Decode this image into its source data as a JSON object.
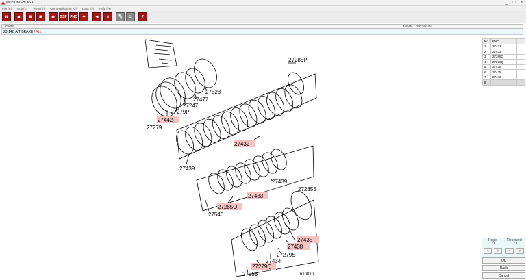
{
  "window": {
    "title": "MITSUBISHI ASA",
    "controls": [
      "_",
      "□",
      "×"
    ]
  },
  "menu": [
    "File (F)",
    "Edit (E)",
    "View (V)",
    "Communication (C)",
    "Data (D)",
    "Help (H)"
  ],
  "toolbar": {
    "buttons": [
      {
        "name": "exit",
        "glyph": "▮▮"
      },
      {
        "name": "tool-2",
        "glyph": "◼"
      },
      {
        "name": "print",
        "glyph": "▤"
      },
      {
        "name": "tool-4",
        "glyph": "▣"
      },
      {
        "name": "tool-5",
        "glyph": "◉"
      },
      {
        "name": "gsp",
        "glyph": "GSP"
      },
      {
        "name": "pnc",
        "glyph": "PNC"
      },
      {
        "name": "tool-8",
        "glyph": "✚"
      },
      {
        "name": "tool-9",
        "glyph": "◀"
      },
      {
        "name": "tool-10",
        "glyph": "▮"
      },
      {
        "name": "tool-11",
        "glyph": "▚"
      },
      {
        "name": "tool-12",
        "glyph": "⟳"
      },
      {
        "name": "help",
        "glyph": "?"
      }
    ]
  },
  "info": {
    "tab": "CAPS",
    "region": "JAPAN",
    "date": "2022/03/04",
    "breadcrumb": "23-14B  A/T BRAKE /",
    "breadcrumb_all": "ALL"
  },
  "diagram": {
    "labels": {
      "l27528": "27528",
      "l27477": "27477",
      "l27247": "27247",
      "l27279P": "27279P",
      "l27442": "27442",
      "l27279": "27279",
      "l27285P": "27285P",
      "l27432": "27432",
      "l27439a": "27439",
      "l27439b": "27439",
      "l27433": "27433",
      "l27285Q": "27285Q",
      "l27546": "27546",
      "l27285S": "27285S",
      "l27435": "27435",
      "l27438": "27438",
      "l27279S": "27279S",
      "l27434": "27434",
      "l27279Q": "27279Q",
      "l27558": "27558",
      "code": "610010"
    }
  },
  "panel": {
    "headers": [
      "No",
      "PNC",
      ""
    ],
    "rows": [
      {
        "no": "1",
        "pnc": "27432"
      },
      {
        "no": "2",
        "pnc": "27433"
      },
      {
        "no": "3",
        "pnc": "27285Q"
      },
      {
        "no": "4",
        "pnc": "27279Q"
      },
      {
        "no": "5",
        "pnc": "27438"
      },
      {
        "no": "6",
        "pnc": "27435"
      },
      {
        "no": "7",
        "pnc": "27442"
      },
      {
        "no": "8",
        "pnc": ""
      }
    ],
    "page_label": "Page",
    "page_value": "1 / 1",
    "reserved_label": "Reserved",
    "reserved_value": "1 / 1",
    "prev": "<",
    "next": ">",
    "ok": "OK",
    "back": "Back",
    "cancel": "Cancel"
  }
}
